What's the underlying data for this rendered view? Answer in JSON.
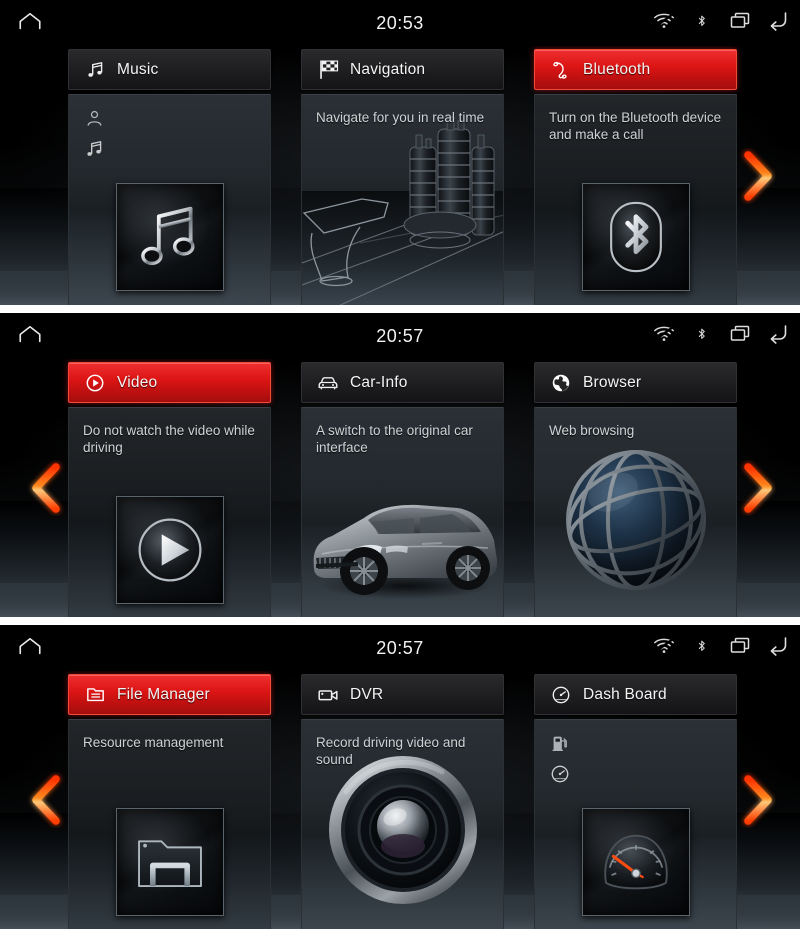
{
  "device": {
    "name": "car-head-unit-launcher",
    "accent_red": "#dc1414",
    "arrow_gradient_from": "#ff2a00",
    "arrow_gradient_to": "#ffb347"
  },
  "statusbar": {
    "home_icon": "home-icon",
    "icons": [
      "wifi-icon",
      "bluetooth-icon",
      "recent-apps-icon",
      "back-icon"
    ]
  },
  "panels": [
    {
      "id": "page-1",
      "clock": "20:53",
      "has_prev_arrow": false,
      "has_next_arrow": true,
      "cards": [
        {
          "title": "Music",
          "header_icon": "music-note-icon",
          "highlighted": false,
          "description": "",
          "mini_icons": [
            "person-icon",
            "music-note-icon"
          ],
          "thumb_art": "music-note-thumb"
        },
        {
          "title": "Navigation",
          "header_icon": "checkered-flag-icon",
          "highlighted": false,
          "description": "Navigate for you in real time",
          "mini_icons": [],
          "thumb_art": "city-skyline-art"
        },
        {
          "title": "Bluetooth",
          "header_icon": "phone-handset-icon",
          "highlighted": true,
          "description": "Turn on the Bluetooth device and make a call",
          "mini_icons": [],
          "thumb_art": "bluetooth-thumb"
        }
      ]
    },
    {
      "id": "page-2",
      "clock": "20:57",
      "has_prev_arrow": true,
      "has_next_arrow": true,
      "cards": [
        {
          "title": "Video",
          "header_icon": "play-circle-icon",
          "highlighted": true,
          "description": "Do not watch the video while driving",
          "mini_icons": [],
          "thumb_art": "play-button-thumb"
        },
        {
          "title": "Car-Info",
          "header_icon": "car-front-icon",
          "highlighted": false,
          "description": "A switch to the original car interface",
          "mini_icons": [],
          "thumb_art": "sedan-car-art"
        },
        {
          "title": "Browser",
          "header_icon": "globe-icon",
          "highlighted": false,
          "description": "Web browsing",
          "mini_icons": [],
          "thumb_art": "globe-art"
        }
      ]
    },
    {
      "id": "page-3",
      "clock": "20:57",
      "has_prev_arrow": true,
      "has_next_arrow": true,
      "cards": [
        {
          "title": "File Manager",
          "header_icon": "file-icon",
          "highlighted": true,
          "description": "Resource management",
          "mini_icons": [],
          "thumb_art": "folder-thumb"
        },
        {
          "title": "DVR",
          "header_icon": "video-camera-icon",
          "highlighted": false,
          "description": "Record driving video and sound",
          "mini_icons": [],
          "thumb_art": "camera-lens-art"
        },
        {
          "title": "Dash Board",
          "header_icon": "gauge-icon",
          "highlighted": false,
          "description": "",
          "mini_icons": [
            "fuel-pump-icon",
            "gauge-icon"
          ],
          "thumb_art": "speedometer-thumb"
        }
      ]
    }
  ]
}
